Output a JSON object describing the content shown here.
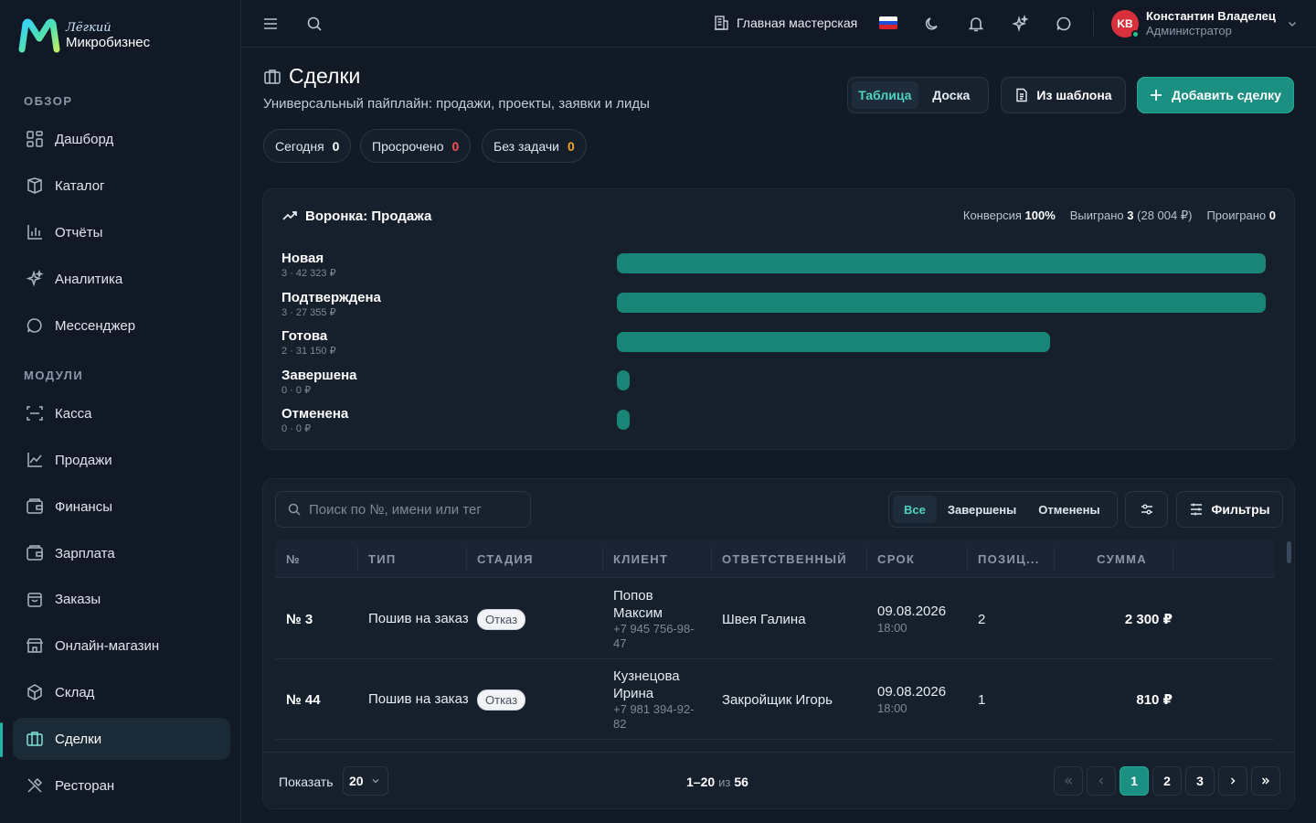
{
  "brand": {
    "top": "Лёгкий",
    "bottom": "Микробизнес"
  },
  "sidebar": {
    "section_overview": "ОБЗОР",
    "section_modules": "МОДУЛИ",
    "overview_items": [
      {
        "label": "Дашборд",
        "icon": "dashboard-icon"
      },
      {
        "label": "Каталог",
        "icon": "catalog-icon"
      },
      {
        "label": "Отчёты",
        "icon": "reports-icon"
      },
      {
        "label": "Аналитика",
        "icon": "sparkles-icon"
      },
      {
        "label": "Мессенджер",
        "icon": "chat-icon"
      }
    ],
    "module_items": [
      {
        "label": "Касса",
        "icon": "scan-icon"
      },
      {
        "label": "Продажи",
        "icon": "line-chart-icon"
      },
      {
        "label": "Финансы",
        "icon": "wallet-icon"
      },
      {
        "label": "Зарплата",
        "icon": "wallet-icon"
      },
      {
        "label": "Заказы",
        "icon": "bag-icon"
      },
      {
        "label": "Онлайн-магазин",
        "icon": "store-icon"
      },
      {
        "label": "Склад",
        "icon": "box-icon"
      },
      {
        "label": "Сделки",
        "icon": "briefcase-icon"
      },
      {
        "label": "Ресторан",
        "icon": "utensils-icon"
      }
    ],
    "active_item": "Сделки"
  },
  "topbar": {
    "workshop": "Главная мастерская",
    "user_initials": "KB",
    "user_name": "Константин Владелец",
    "user_role": "Администратор"
  },
  "page": {
    "title": "Сделки",
    "subtitle": "Универсальный пайплайн: продажи, проекты, заявки и лиды",
    "view_table": "Таблица",
    "view_board": "Доска",
    "from_template": "Из шаблона",
    "add_deal": "Добавить сделку"
  },
  "chips": [
    {
      "label": "Сегодня",
      "count": "0",
      "color": "#ffffff"
    },
    {
      "label": "Просрочено",
      "count": "0",
      "color": "#f05252"
    },
    {
      "label": "Без задачи",
      "count": "0",
      "color": "#f5a524"
    }
  ],
  "funnel": {
    "title": "Воронка: Продажа",
    "conversion_label": "Конверсия",
    "conversion_value": "100%",
    "won_label": "Выиграно",
    "won_value": "3",
    "won_sum": "(28 004 ₽)",
    "lost_label": "Проиграно",
    "lost_value": "0",
    "stages": [
      {
        "name": "Новая",
        "meta": "3 · 42 323 ₽",
        "fraction": 1.0
      },
      {
        "name": "Подтверждена",
        "meta": "3 · 27 355 ₽",
        "fraction": 1.0
      },
      {
        "name": "Готова",
        "meta": "2 · 31 150 ₽",
        "fraction": 0.667
      },
      {
        "name": "Завершена",
        "meta": "0 · 0 ₽",
        "fraction": 0
      },
      {
        "name": "Отменена",
        "meta": "0 · 0 ₽",
        "fraction": 0
      }
    ]
  },
  "table": {
    "search_placeholder": "Поиск по №, имени или тег",
    "filter_all": "Все",
    "filter_done": "Завершены",
    "filter_cancelled": "Отменены",
    "filters_label": "Фильтры",
    "columns": [
      "№",
      "ТИП",
      "СТАДИЯ",
      "КЛИЕНТ",
      "ОТВЕТСТВЕННЫЙ",
      "СРОК",
      "ПОЗИЦ...",
      "СУММА"
    ],
    "rows": [
      {
        "num": "№ 3",
        "type": "Пошив на заказ",
        "stage": "Отказ",
        "client": "Попов Максим",
        "phone": "+7 945 756-98-47",
        "responsible": "Швея Галина",
        "date": "09.08.2026",
        "time": "18:00",
        "qty": "2",
        "sum": "2 300 ₽"
      },
      {
        "num": "№ 44",
        "type": "Пошив на заказ",
        "stage": "Отказ",
        "client": "Кузнецова Ирина",
        "phone": "+7 981 394-92-82",
        "responsible": "Закройщик Игорь",
        "date": "09.08.2026",
        "time": "18:00",
        "qty": "1",
        "sum": "810 ₽"
      }
    ]
  },
  "pagination": {
    "show_label": "Показать",
    "page_size": "20",
    "range": "1–20",
    "of": "из",
    "total": "56",
    "pages": [
      "1",
      "2",
      "3"
    ],
    "current": "1"
  }
}
